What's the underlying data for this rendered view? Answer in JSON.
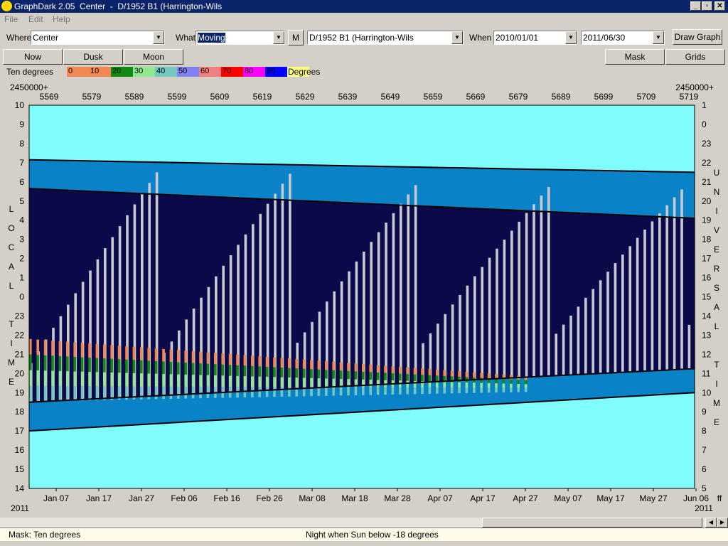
{
  "window": {
    "title": "GraphDark 2.05  Center  -  D/1952 B1 (Harrington-Wils",
    "min_symbol": "_",
    "max_symbol": "▫",
    "close_symbol": "✕"
  },
  "menu": [
    "File",
    "Edit",
    "Help"
  ],
  "toolbar": {
    "where_label": "Where",
    "where_value": "Center",
    "what_label": "What",
    "what_value": "Moving",
    "m_button": "M",
    "object_value": "D/1952 B1 (Harrington-Wils",
    "when_label": "When",
    "start_date": "2010/01/01",
    "end_date": "2011/06/30",
    "draw_button": "Draw Graph"
  },
  "buttons": {
    "now": "Now",
    "dusk": "Dusk",
    "moon": "Moon",
    "mask": "Mask",
    "grids": "Grids"
  },
  "legend": {
    "title": "Ten degrees",
    "unit": "Degrees",
    "items": [
      {
        "label": "0",
        "color": "#f08850"
      },
      {
        "label": "10",
        "color": "#f08850"
      },
      {
        "label": "20",
        "color": "#108a10"
      },
      {
        "label": "30",
        "color": "#90e890"
      },
      {
        "label": "40",
        "color": "#70c8c0"
      },
      {
        "label": "50",
        "color": "#8080f0"
      },
      {
        "label": "60",
        "color": "#f08080"
      },
      {
        "label": "70",
        "color": "#ff0000"
      },
      {
        "label": "80",
        "color": "#ff00ff"
      },
      {
        "label": "90",
        "color": "#0000ff"
      },
      {
        "label": "",
        "color": "#ffff88"
      }
    ]
  },
  "colors": {
    "sky_day": "#80fcfc",
    "twilight": "#0a82c8",
    "night": "#0a0a4a",
    "moon": "#c8c8d0"
  },
  "chart_data": {
    "type": "visibility-graph",
    "jd_prefix_left": "2450000+",
    "jd_prefix_right": "2450000+",
    "jd_ticks": [
      "5569",
      "5579",
      "5589",
      "5599",
      "5609",
      "5619",
      "5629",
      "5639",
      "5649",
      "5659",
      "5669",
      "5679",
      "5689",
      "5699",
      "5709",
      "5719"
    ],
    "x_ticks": [
      "Jan 07",
      "Jan 17",
      "Jan 27",
      "Feb 06",
      "Feb 16",
      "Feb 26",
      "Mar 08",
      "Mar 18",
      "Mar 28",
      "Apr 07",
      "Apr 17",
      "Apr 27",
      "May 07",
      "May 17",
      "May 27",
      "Jun 06"
    ],
    "year_left": "2011",
    "year_right": "2011",
    "x_unit": "ff",
    "left_axis_title": [
      "L",
      "O",
      "C",
      "A",
      "L",
      "",
      "T",
      "I",
      "M",
      "E"
    ],
    "right_axis_title": [
      "U",
      "N",
      "I",
      "V",
      "E",
      "R",
      "S",
      "A",
      "L",
      "",
      "T",
      "I",
      "M",
      "E"
    ],
    "local_time_ticks": [
      "10",
      "9",
      "8",
      "7",
      "6",
      "5",
      "4",
      "3",
      "2",
      "1",
      "0",
      "23",
      "22",
      "21",
      "20",
      "19",
      "18",
      "17",
      "16",
      "15",
      "14"
    ],
    "universal_time_ticks": [
      "1",
      "0",
      "23",
      "22",
      "21",
      "20",
      "19",
      "18",
      "17",
      "16",
      "15",
      "14",
      "13",
      "12",
      "11",
      "10",
      "9",
      "8",
      "7",
      "6",
      "5"
    ],
    "evening_sunset_local": [
      7.15,
      6.5
    ],
    "evening_dark_local": [
      5.65,
      4.1
    ],
    "morning_dark_local": [
      18.5,
      20.25
    ],
    "morning_sunrise_local": [
      17.0,
      19.0
    ]
  },
  "status": {
    "mask_text": "Mask:  Ten degrees",
    "night_text": "Night when Sun below -18 degrees"
  }
}
